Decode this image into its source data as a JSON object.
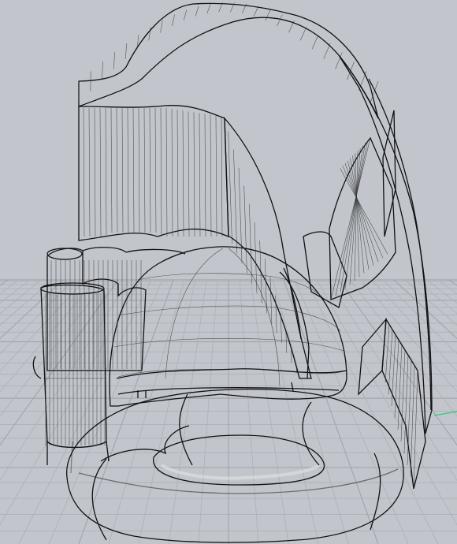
{
  "viewport": {
    "background": "#c2c6cc",
    "grid_color": "#b0b4ba",
    "surface_color": "#d4d4d4",
    "edge_color": "#111111",
    "axis_x_color": "#c0392b",
    "axis_y_color": "#27ae60",
    "display_mode": "shaded",
    "objects": [
      "torus",
      "hemisphere-dome",
      "swept-arch-surface",
      "ribbon-surface",
      "tall-curved-wall",
      "cylinder-cluster",
      "fan-surface"
    ]
  }
}
